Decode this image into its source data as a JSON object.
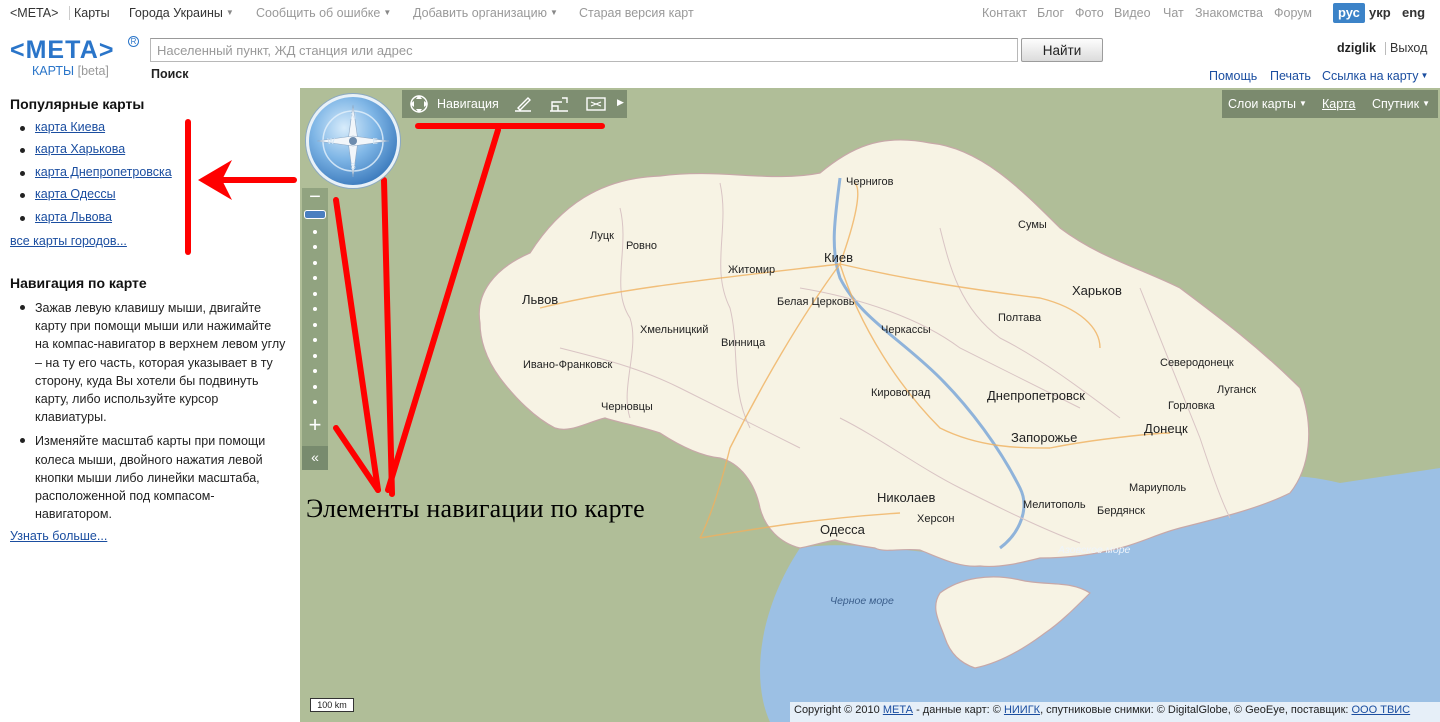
{
  "topnav": {
    "brand": "<META>",
    "items": [
      "Карты",
      "Города Украины",
      "Сообщить об ошибке",
      "Добавить организацию",
      "Старая версия карт"
    ],
    "right_links": [
      "Контакт",
      "Блог",
      "Фото",
      "Видео",
      "Чат",
      "Знакомства",
      "Форум"
    ],
    "langs": [
      "рус",
      "укр",
      "eng"
    ]
  },
  "logo": {
    "main": "<МЕТА>",
    "reg": "R",
    "sub": "КАРТЫ",
    "beta": "[beta]"
  },
  "search": {
    "placeholder": "Населенный пункт, ЖД станция или адрес",
    "value": "",
    "button": "Найти",
    "label": "Поиск"
  },
  "user": {
    "name": "dziglik",
    "logout": "Выход"
  },
  "header_links": {
    "help": "Помощь",
    "print": "Печать",
    "link": "Ссылка на карту"
  },
  "sidebar": {
    "popular_title": "Популярные карты",
    "popular": [
      "карта Киева",
      "карта Харькова",
      "карта Днепропетровска",
      "карта Одессы",
      "карта Львова"
    ],
    "all_cities": "все карты городов...",
    "nav_title": "Навигация по карте",
    "nav_items": [
      "Зажав левую клавишу мыши, двигайте карту при помощи мыши или нажимайте на компас-навигатор в верхнем левом углу – на ту его часть, которая указывает в ту сторону, куда Вы хотели бы подвинуть карту, либо используйте курсор клавиатуры.",
      "Изменяйте масштаб карты при помощи колеса мыши, двойного нажатия левой кнопки мыши либо линейки масштаба, расположенной под компасом-навигатором."
    ],
    "learn_more": "Узнать больше..."
  },
  "map": {
    "toolbar_label": "Навигация",
    "layers": "Слои карты",
    "map_mode": "Карта",
    "satellite": "Спутник",
    "scale": "100 km",
    "annotation": "Элементы навигации по карте",
    "copyright_pre": "Copyright © 2010 ",
    "copyright_meta": "МЕТА",
    "copyright_mid": " - данные карт: © ",
    "copyright_niigk": "НИИГК",
    "copyright_mid2": ", спутниковые снимки: © DigitalGlobe, © GeoEye, поставщик: ",
    "copyright_tvis": "ООО ТВИС",
    "cities": {
      "kiev": "Киев",
      "kharkov": "Харьков",
      "dnepr": "Днепропетровск",
      "zaporozhye": "Запорожье",
      "donetsk": "Донецк",
      "odessa": "Одесса",
      "lvov": "Львов",
      "chernigov": "Чернигов",
      "sumy": "Сумы",
      "poltava": "Полтава",
      "cherkassy": "Черкассы",
      "zhitomir": "Житомир",
      "lutsk": "Луцк",
      "rovno": "Ровно",
      "bc": "Белая Церковь",
      "khmel": "Хмельницкий",
      "vinnica": "Винница",
      "ivano": "Ивано-Франковск",
      "chernovcy": "Черновцы",
      "kirovograd": "Кировоград",
      "nikolaev": "Николаев",
      "kherson": "Херсон",
      "melitopol": "Мелитополь",
      "berdyansk": "Бердянск",
      "mariupol": "Мариуполь",
      "gorlovka": "Горловка",
      "lugansk": "Луганск",
      "severodonetsk": "Северодонецк"
    },
    "seas": {
      "black": "Черное море",
      "azov": "Азовское море"
    }
  },
  "colors": {
    "accent": "#2a75c9",
    "link": "#1b4ea0",
    "map_bg": "#b0be98",
    "land": "#f7f3e4",
    "sea": "#9cc0e4",
    "annotation_arrow": "#ff0000"
  }
}
